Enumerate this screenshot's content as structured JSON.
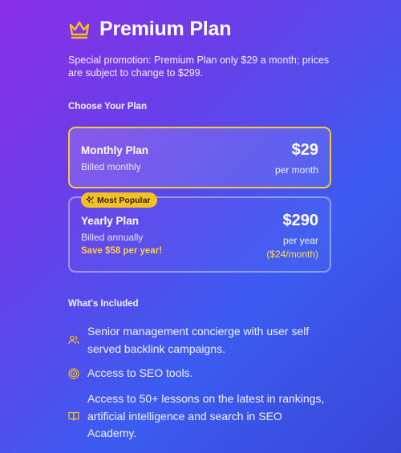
{
  "header": {
    "title": "Premium Plan"
  },
  "promo": "Special promotion: Premium Plan only $29 a month; prices are subject to change to $299.",
  "choose_label": "Choose Your Plan",
  "plans": [
    {
      "name": "Monthly Plan",
      "billing": "Billed monthly",
      "price": "$29",
      "period": "per month",
      "selected": true
    },
    {
      "name": "Yearly Plan",
      "billing": "Billed annually",
      "save": "Save $58 per year!",
      "price": "$290",
      "period": "per year",
      "equiv": "($24/month)",
      "badge": "Most Popular",
      "selected": false
    }
  ],
  "included_label": "What's Included",
  "features": [
    {
      "icon": "users-icon",
      "text": "Senior management concierge with user self served backlink campaigns."
    },
    {
      "icon": "target-icon",
      "text": "Access to SEO tools."
    },
    {
      "icon": "book-icon",
      "text": "Access to 50+ lessons on the latest in rankings, artificial intelligence and search in SEO Academy."
    }
  ],
  "colors": {
    "accent": "#f5c21b",
    "gradient_start": "#8a2fe6",
    "gradient_end": "#3a46d8"
  }
}
